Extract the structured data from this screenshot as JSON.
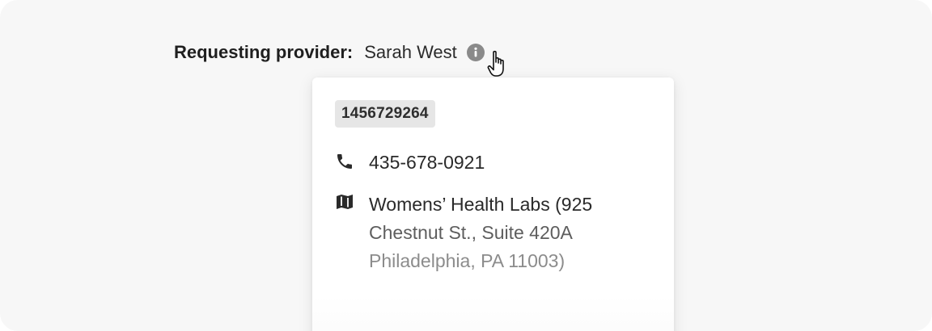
{
  "provider": {
    "label": "Requesting provider:",
    "name": "Sarah West",
    "info_icon": "info-icon"
  },
  "popover": {
    "npi": "1456729264",
    "phone": "435-678-0921",
    "phone_icon": "phone-icon",
    "map_icon": "map-icon",
    "address_lines": [
      "Womens’ Health Labs (925",
      "Chestnut St., Suite 420A",
      "Philadelphia, PA 11003)"
    ]
  },
  "colors": {
    "background": "#f7f7f7",
    "card": "#ffffff",
    "badge": "#e6e6e6",
    "info_icon": "#8a8a8a"
  }
}
